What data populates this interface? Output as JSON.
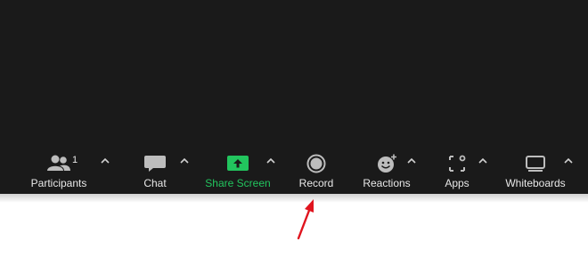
{
  "toolbar": {
    "participants": {
      "label": "Participants",
      "count": "1",
      "icon": "participants-icon"
    },
    "chat": {
      "label": "Chat",
      "icon": "chat-icon"
    },
    "share_screen": {
      "label": "Share Screen",
      "icon": "share-screen-icon"
    },
    "record": {
      "label": "Record",
      "icon": "record-icon"
    },
    "reactions": {
      "label": "Reactions",
      "icon": "reactions-icon"
    },
    "apps": {
      "label": "Apps",
      "icon": "apps-icon"
    },
    "whiteboards": {
      "label": "Whiteboards",
      "icon": "whiteboards-icon"
    }
  },
  "colors": {
    "toolbar_bg": "#1a1a1a",
    "text": "#e8e8e8",
    "share_accent": "#22c55e",
    "annotation_arrow": "#e0141e"
  }
}
